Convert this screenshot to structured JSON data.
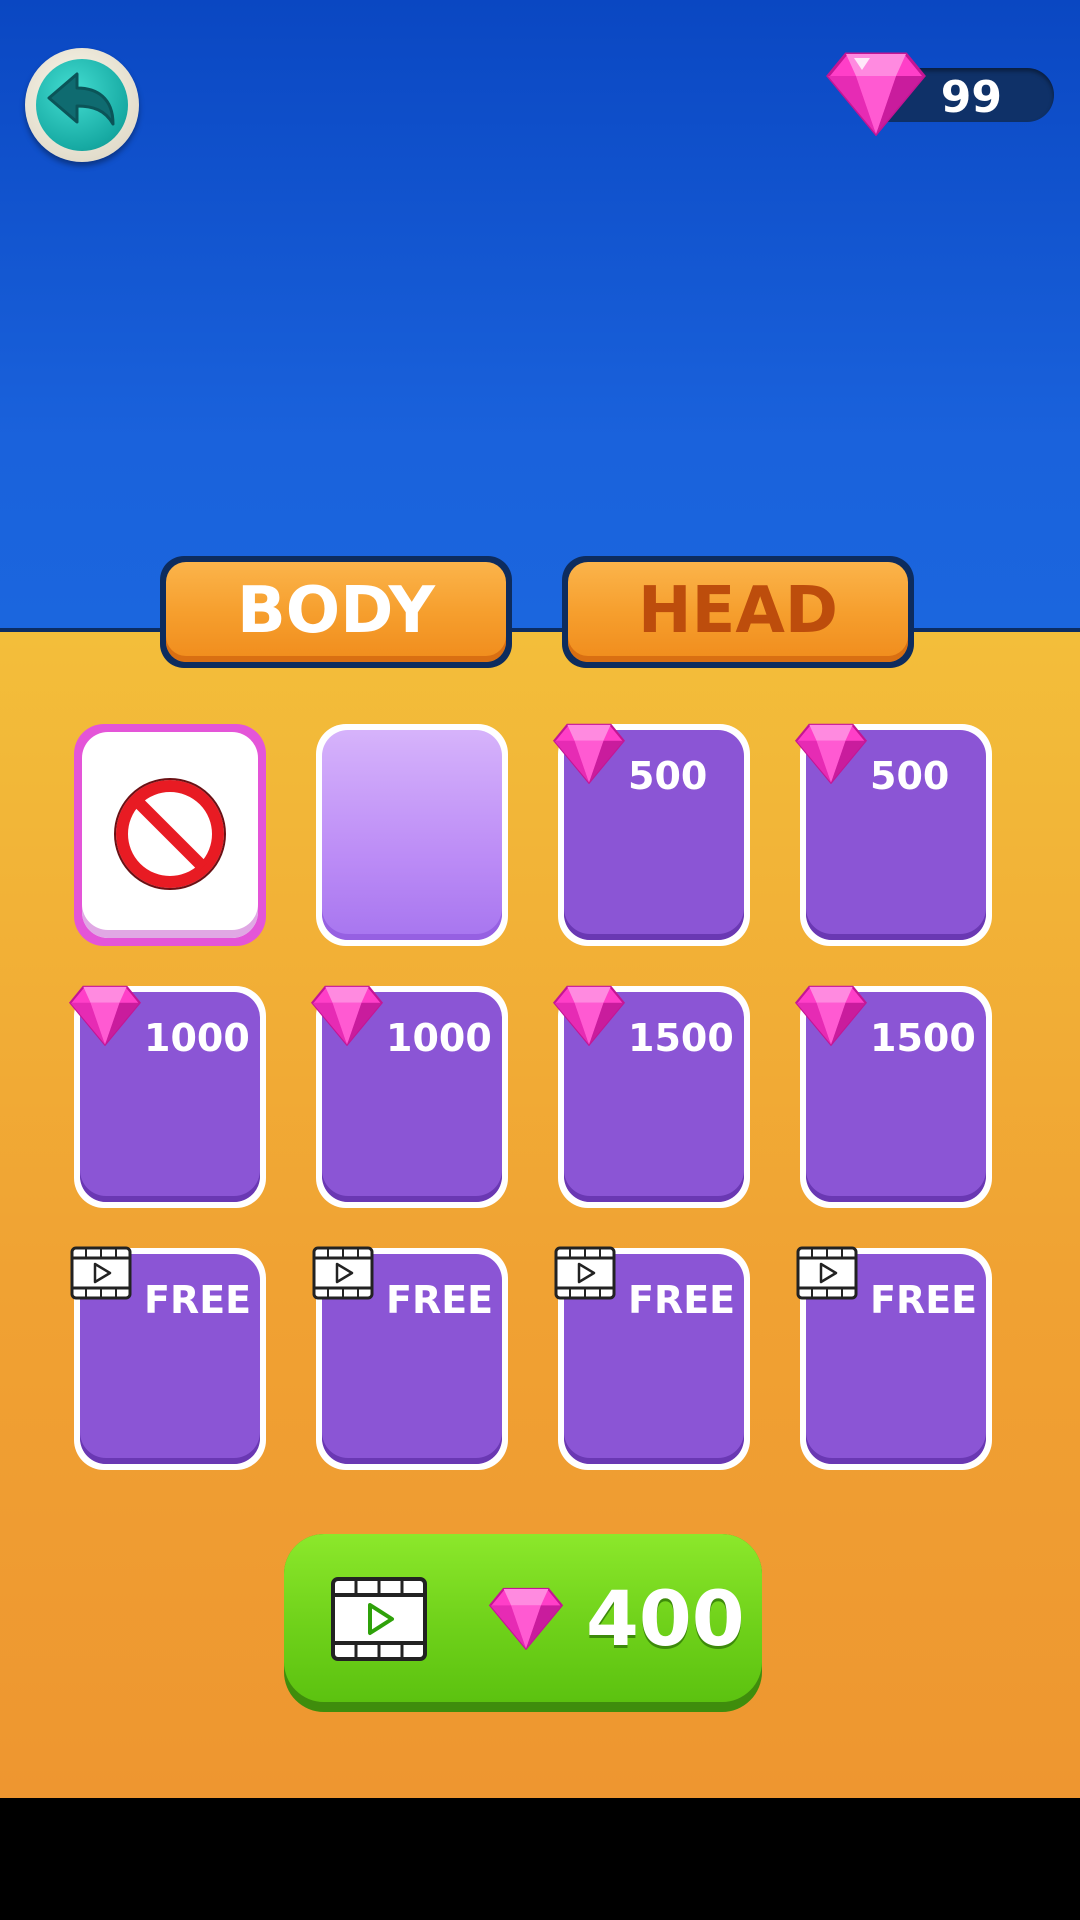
{
  "header": {
    "back_icon": "back-arrow-icon",
    "gem_count": "99",
    "gem_icon": "pink-gem-icon"
  },
  "tabs": [
    {
      "label": "BODY",
      "color": "#ffffff"
    },
    {
      "label": "HEAD",
      "color": "#bd4d0c"
    }
  ],
  "items": [
    {
      "type": "none",
      "icon": "no-entry-icon",
      "selected": true
    },
    {
      "type": "empty"
    },
    {
      "type": "gem",
      "price": "500"
    },
    {
      "type": "gem",
      "price": "500"
    },
    {
      "type": "gem",
      "price": "1000"
    },
    {
      "type": "gem",
      "price": "1000"
    },
    {
      "type": "gem",
      "price": "1500"
    },
    {
      "type": "gem",
      "price": "1500"
    },
    {
      "type": "video",
      "price": "FREE"
    },
    {
      "type": "video",
      "price": "FREE"
    },
    {
      "type": "video",
      "price": "FREE"
    },
    {
      "type": "video",
      "price": "FREE"
    }
  ],
  "watch_button": {
    "icon": "video-film-icon",
    "gem_icon": "pink-gem-icon",
    "reward": "400"
  },
  "colors": {
    "sky": "#1a62dc",
    "floor": "#f0a233",
    "card": "#8b55d5",
    "gem": "#ff3fc8",
    "button_green": "#6fd11a"
  }
}
